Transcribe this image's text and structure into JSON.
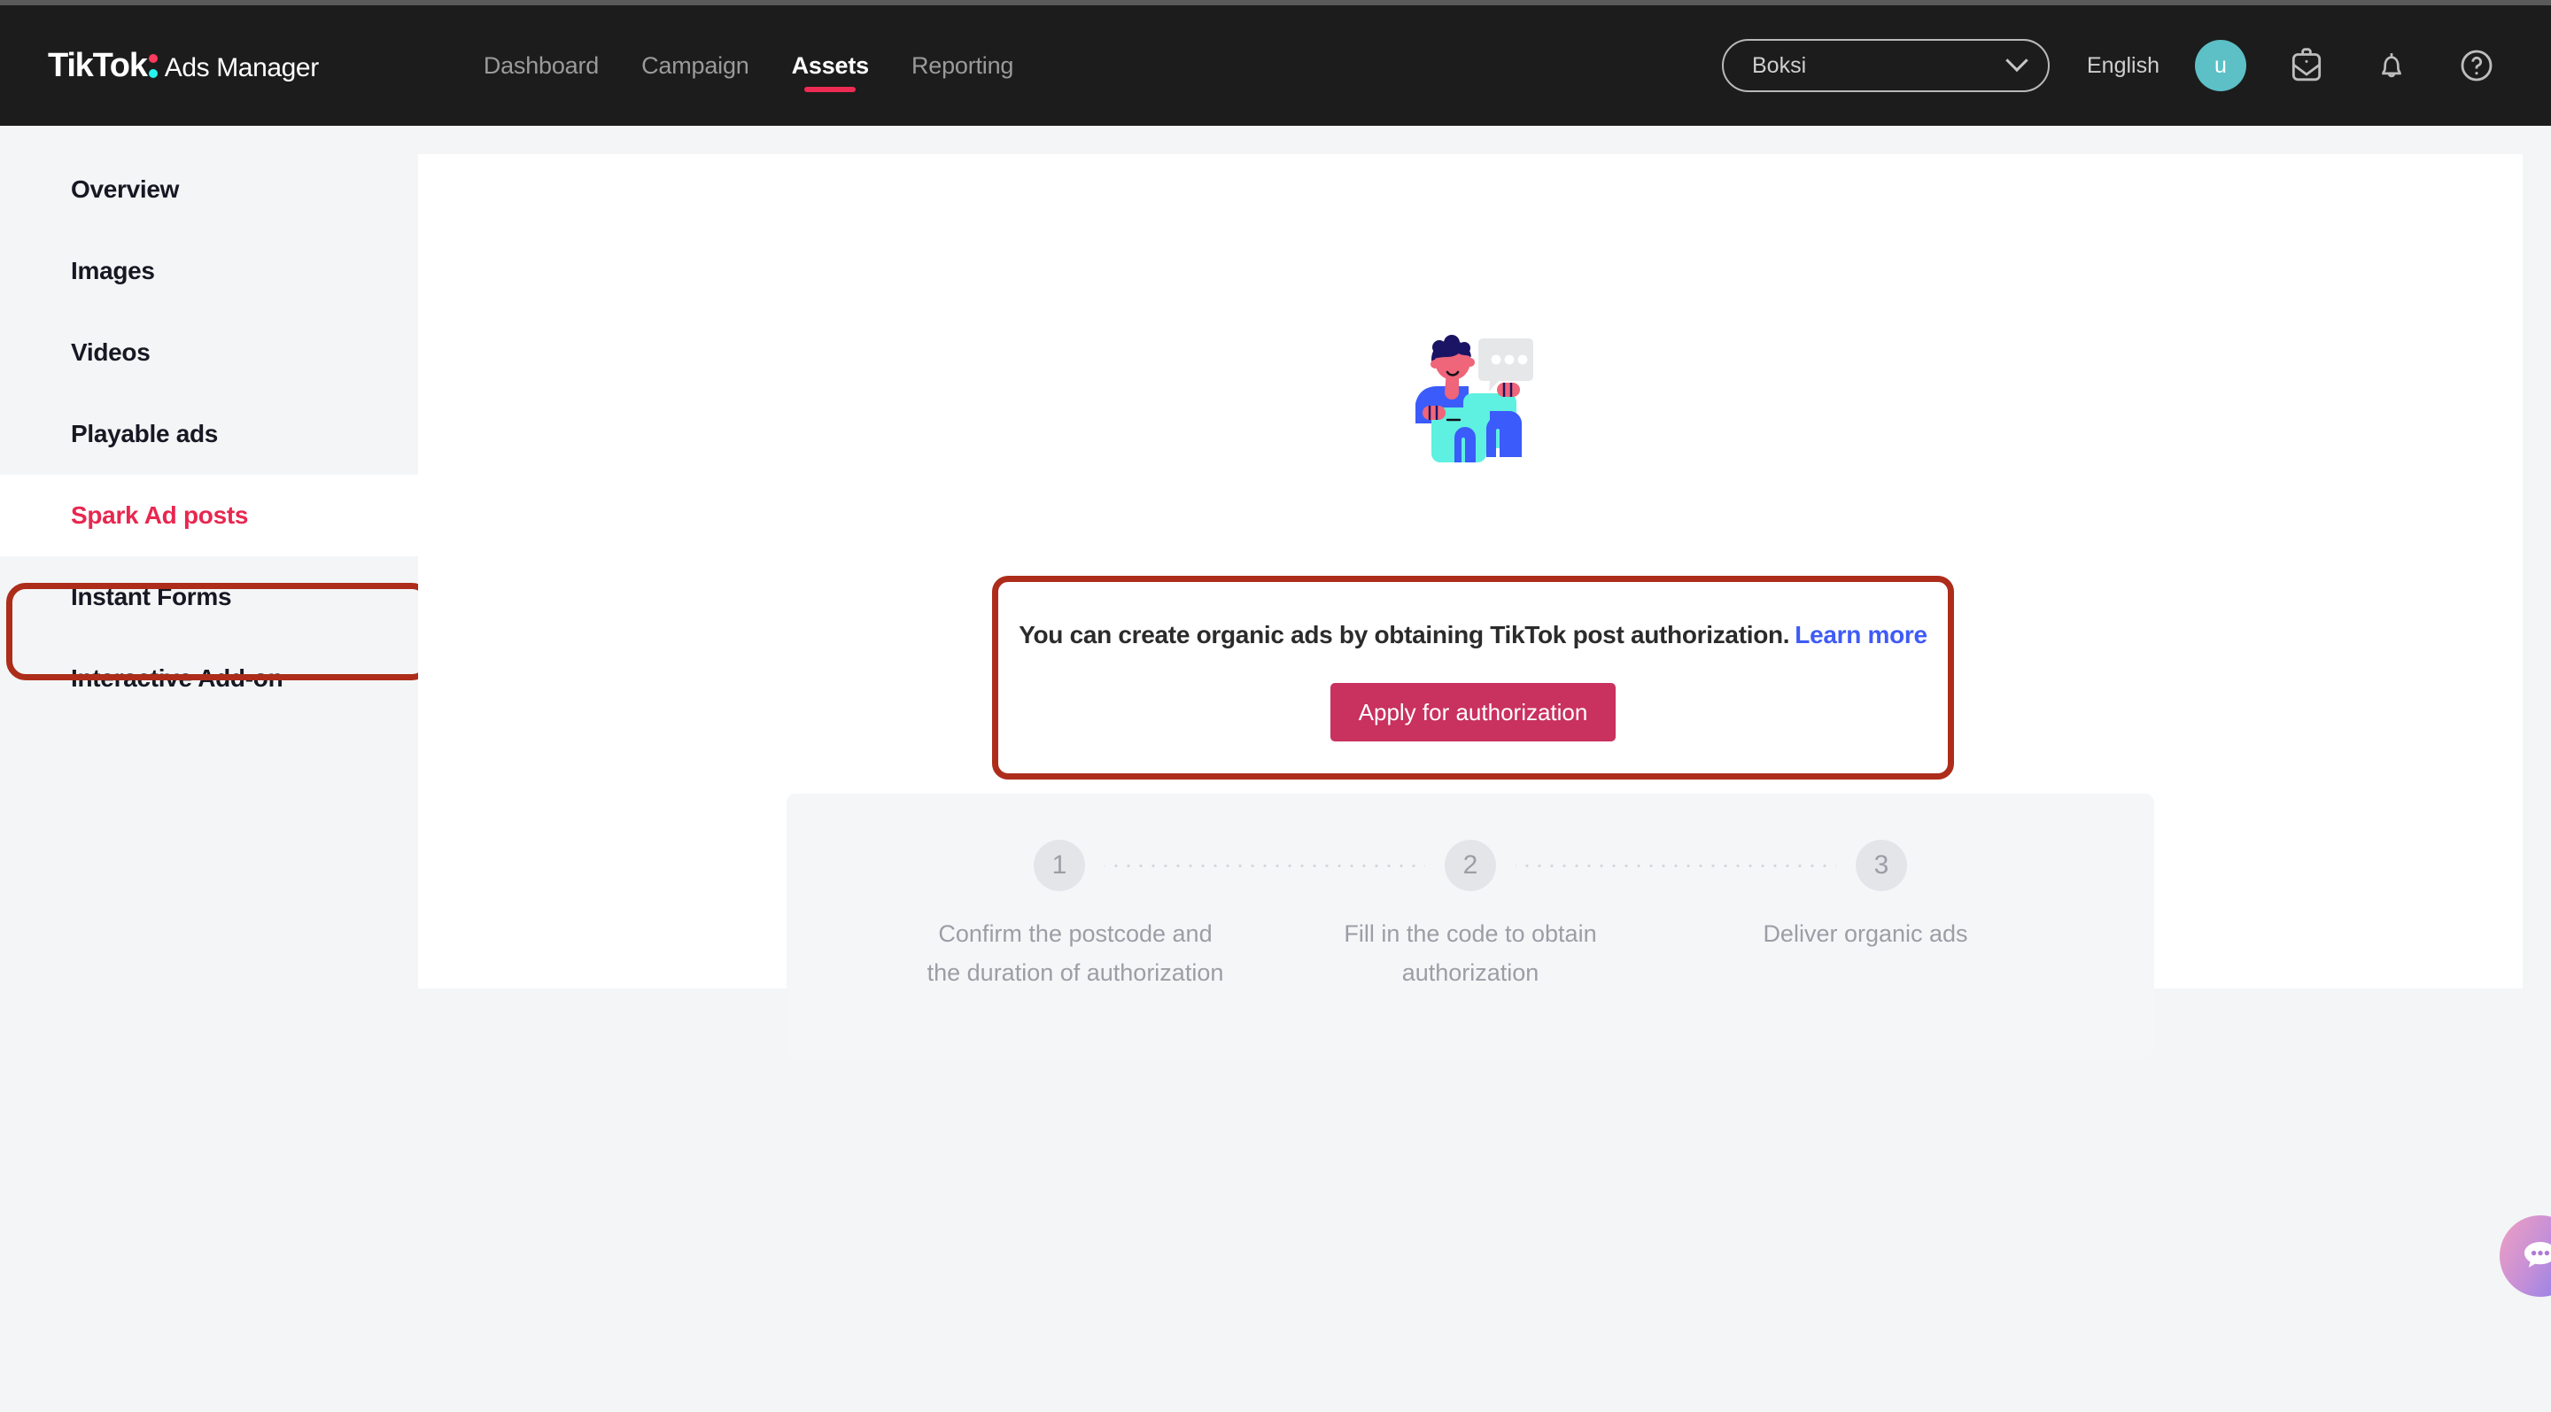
{
  "brand": {
    "name": "TikTok",
    "product": "Ads Manager",
    "colon_top_color": "#ff3b5c",
    "colon_bottom_color": "#25f4ee"
  },
  "nav": {
    "items": [
      {
        "label": "Dashboard",
        "active": false
      },
      {
        "label": "Campaign",
        "active": false
      },
      {
        "label": "Assets",
        "active": true
      },
      {
        "label": "Reporting",
        "active": false
      }
    ],
    "active_underline_color": "#ee2b53"
  },
  "header_right": {
    "account": "Boksi",
    "language": "English",
    "avatar_initial": "u",
    "avatar_color": "#5cc0c6",
    "icons": [
      "chevron-down-icon",
      "inbox-icon",
      "bell-icon",
      "help-icon"
    ]
  },
  "sidebar": {
    "items": [
      {
        "label": "Overview",
        "active": false
      },
      {
        "label": "Images",
        "active": false
      },
      {
        "label": "Videos",
        "active": false
      },
      {
        "label": "Playable ads",
        "active": false
      },
      {
        "label": "Spark Ad posts",
        "active": true
      },
      {
        "label": "Instant Forms",
        "active": false
      },
      {
        "label": "Interactive Add-on",
        "active": false
      }
    ],
    "active_color": "#e8274f",
    "annotation_color": "#ad2d1a"
  },
  "callout": {
    "message": "You can create organic ads by obtaining TikTok post authorization.",
    "learn_more": "Learn more",
    "learn_more_color": "#3f5bf6",
    "button_label": "Apply for authorization",
    "button_color": "#c9315f",
    "border_color": "#ad2d1a"
  },
  "steps": [
    {
      "number": "1",
      "label": "Confirm the postcode and the duration of authorization"
    },
    {
      "number": "2",
      "label": "Fill in the code to obtain authorization"
    },
    {
      "number": "3",
      "label": "Deliver organic ads"
    }
  ],
  "chat": {
    "icon": "chat-bubble-icon",
    "gradient_start": "#f0a0c0",
    "gradient_end": "#7f7df0"
  }
}
